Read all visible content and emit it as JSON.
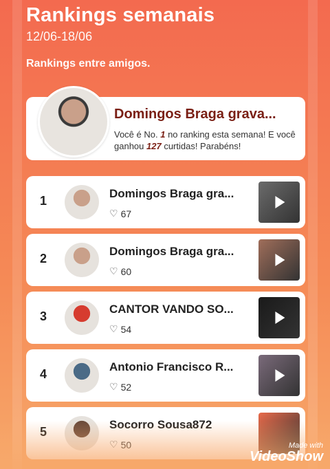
{
  "header": {
    "title": "Rankings semanais",
    "dates": "12/06-18/06",
    "subtitle": "Rankings entre amigos."
  },
  "hero": {
    "name": "Domingos Braga grava...",
    "msg_prefix": "Você é No. ",
    "rank": "1",
    "msg_mid": " no ranking esta semana! E você ganhou ",
    "likes": "127",
    "msg_suffix": " curtidas! Parabéns!"
  },
  "rows": [
    {
      "rank": "1",
      "name": "Domingos Braga gra...",
      "likes": "67",
      "avatar": "#c9a08a",
      "thumb": "#6b6b6b"
    },
    {
      "rank": "2",
      "name": "Domingos Braga gra...",
      "likes": "60",
      "avatar": "#c9a08a",
      "thumb": "#a06e5a"
    },
    {
      "rank": "3",
      "name": "CANTOR VANDO SO...",
      "likes": "54",
      "avatar": "#d63c2f",
      "thumb": "#1a1a1a"
    },
    {
      "rank": "4",
      "name": "Antonio Francisco R...",
      "likes": "52",
      "avatar": "#4a6a86",
      "thumb": "#7a6a7a"
    },
    {
      "rank": "5",
      "name": "Socorro Sousa872",
      "likes": "50",
      "avatar": "#6a4a3a",
      "thumb": "#e86a4a"
    }
  ],
  "watermark": {
    "small": "Made with",
    "big": "VideoShow"
  }
}
